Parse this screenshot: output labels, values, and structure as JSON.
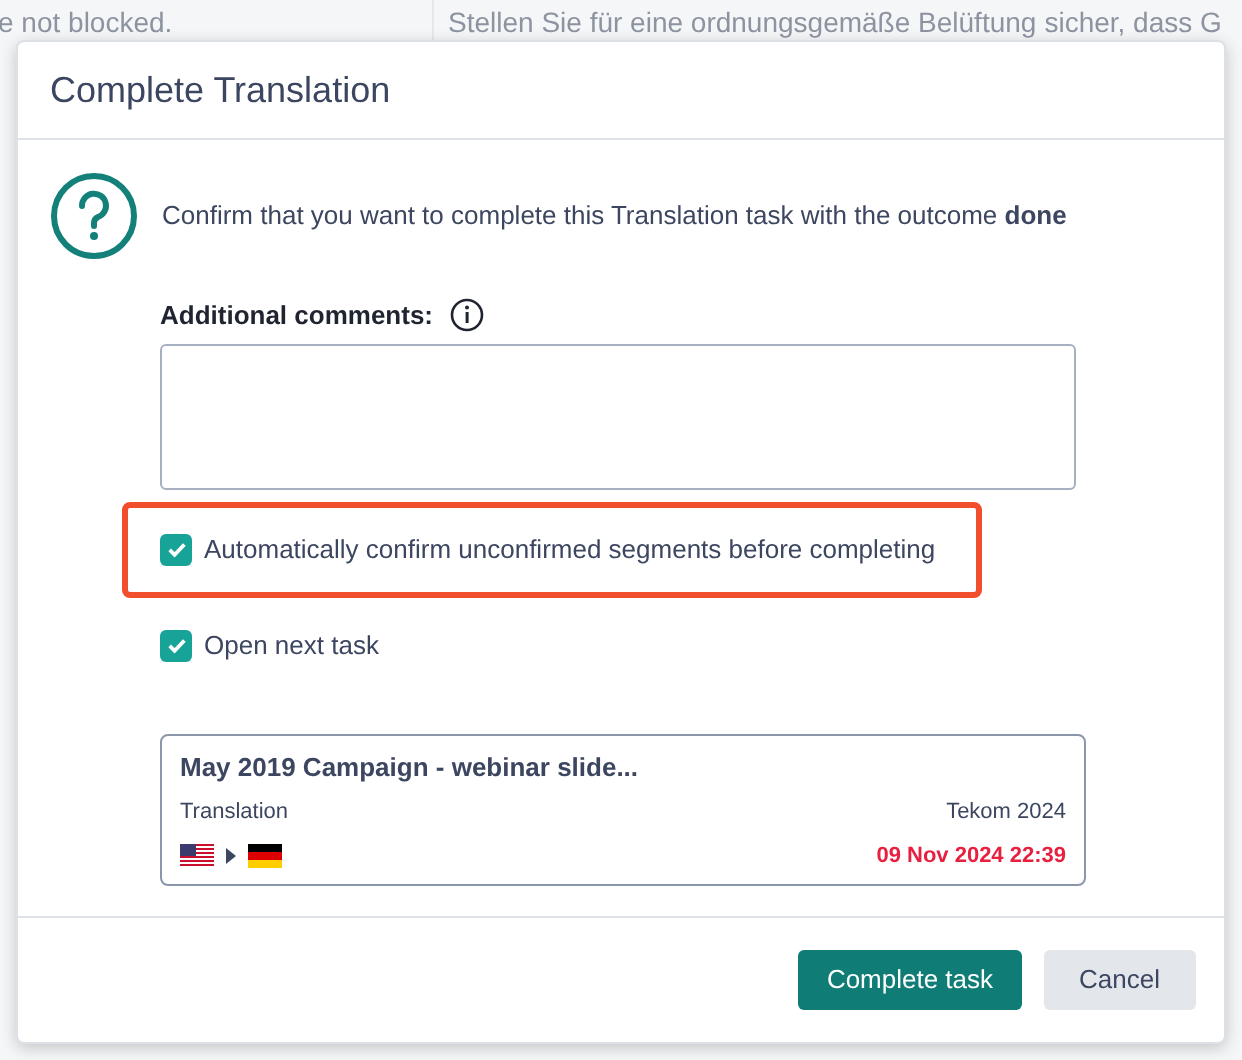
{
  "background": {
    "top_left": "e not blocked.",
    "top_right": "Stellen Sie für eine ordnungsgemäße Belüftung",
    "top_right_after": "sicher, dass G"
  },
  "dialog": {
    "title": "Complete Translation",
    "message": "Confirm that you want to complete this Translation task with the outcome **done**",
    "comments_label": "Additional comments:",
    "options": [
      {
        "label": "Automatically confirm unconfirmed segments before completing",
        "checked": true,
        "highlighted": true
      },
      {
        "label": "Open next task",
        "checked": true,
        "highlighted": false
      }
    ],
    "task": {
      "title": "May 2019 Campaign - webinar slide...",
      "type": "Translation",
      "project": "Tekom 2024",
      "due": "09 Nov 2024 22:39",
      "overdue": true
    },
    "buttons": [
      {
        "label": "Complete task",
        "kind": "primary"
      },
      {
        "label": "Cancel",
        "kind": "secondary"
      }
    ]
  }
}
